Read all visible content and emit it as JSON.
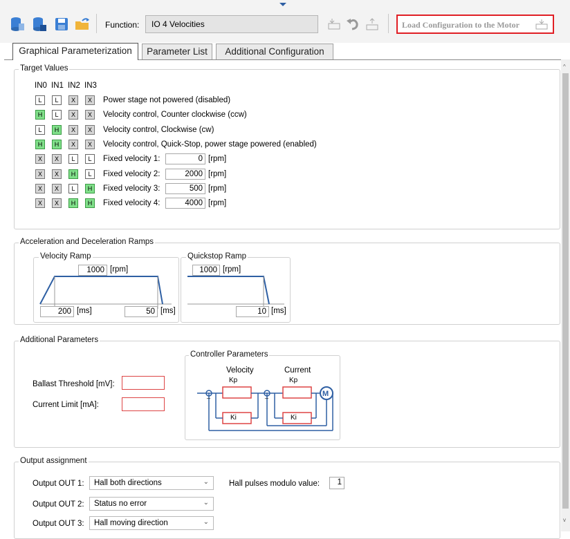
{
  "toolbar": {
    "function_label": "Function:",
    "function_value": "IO 4 Velocities",
    "load_button": "Load Configuration to the Motor"
  },
  "tabs": [
    "Graphical Parameterization",
    "Parameter List",
    "Additional Configuration"
  ],
  "target_values": {
    "title": "Target Values",
    "inputs": [
      "IN0",
      "IN1",
      "IN2",
      "IN3"
    ],
    "rows": [
      {
        "signals": [
          "L",
          "L",
          "X",
          "X"
        ],
        "label": "Power stage not powered (disabled)"
      },
      {
        "signals": [
          "H",
          "L",
          "X",
          "X"
        ],
        "label": "Velocity control, Counter clockwise (ccw)"
      },
      {
        "signals": [
          "L",
          "H",
          "X",
          "X"
        ],
        "label": "Velocity control, Clockwise (cw)"
      },
      {
        "signals": [
          "H",
          "H",
          "X",
          "X"
        ],
        "label": "Velocity control, Quick-Stop, power stage powered (enabled)"
      },
      {
        "signals": [
          "X",
          "X",
          "L",
          "L"
        ],
        "label": "Fixed velocity 1:",
        "value": "0",
        "unit": "[rpm]"
      },
      {
        "signals": [
          "X",
          "X",
          "H",
          "L"
        ],
        "label": "Fixed velocity 2:",
        "value": "2000",
        "unit": "[rpm]"
      },
      {
        "signals": [
          "X",
          "X",
          "L",
          "H"
        ],
        "label": "Fixed velocity 3:",
        "value": "500",
        "unit": "[rpm]"
      },
      {
        "signals": [
          "X",
          "X",
          "H",
          "H"
        ],
        "label": "Fixed velocity 4:",
        "value": "4000",
        "unit": "[rpm]"
      }
    ]
  },
  "ramps": {
    "title": "Acceleration and Deceleration Ramps",
    "velocity": {
      "title": "Velocity Ramp",
      "speed": "1000",
      "speed_unit": "[rpm]",
      "accel": "200",
      "accel_unit": "[ms]",
      "decel": "50",
      "decel_unit": "[ms]"
    },
    "quickstop": {
      "title": "Quickstop Ramp",
      "speed": "1000",
      "speed_unit": "[rpm]",
      "decel": "10",
      "decel_unit": "[ms]"
    }
  },
  "additional": {
    "title": "Additional Parameters",
    "ballast_label": "Ballast Threshold [mV]:",
    "current_label": "Current Limit [mA]:",
    "controller": {
      "title": "Controller Parameters",
      "velocity": "Velocity",
      "current": "Current",
      "kp": "Kp",
      "ki": "Ki",
      "motor": "M"
    }
  },
  "output": {
    "title": "Output assignment",
    "rows": [
      {
        "label": "Output OUT 1:",
        "value": "Hall both directions"
      },
      {
        "label": "Output OUT 2:",
        "value": "Status no error"
      },
      {
        "label": "Output OUT 3:",
        "value": "Hall moving direction"
      }
    ],
    "hall_label": "Hall pulses modulo value:",
    "hall_value": "1"
  },
  "colors": {
    "high": "#80e08a",
    "dontcare": "#d6d6d6",
    "highlight": "#e01e24",
    "diagram": "#2e5fa3"
  }
}
